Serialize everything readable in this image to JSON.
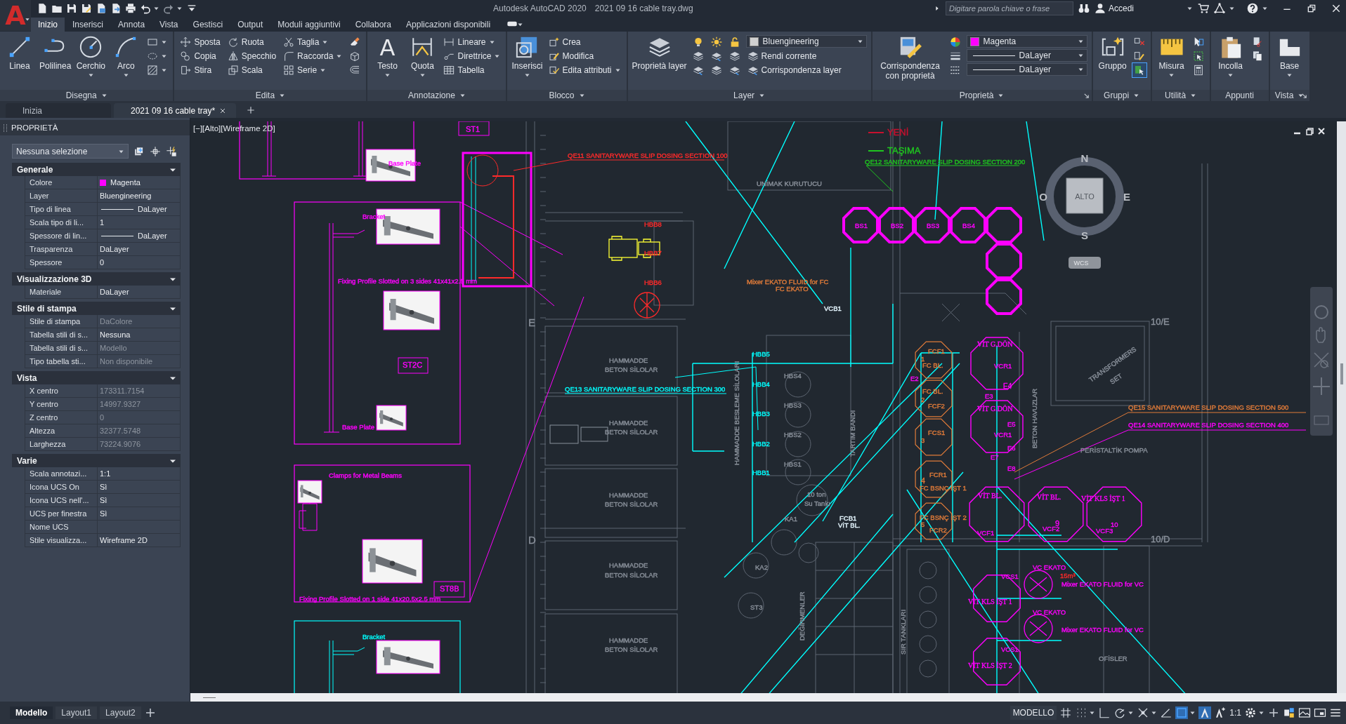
{
  "app_menu": {
    "glyph": "A"
  },
  "window": {
    "app_name": "Autodesk AutoCAD 2020",
    "file_name": "2021 09 16 cable tray.dwg"
  },
  "search": {
    "placeholder": "Digitare parola chiave o frase"
  },
  "sign_in": "Accedi",
  "ribbon_tabs": [
    {
      "label": "Inizio",
      "selected": true
    },
    {
      "label": "Inserisci",
      "selected": false
    },
    {
      "label": "Annota",
      "selected": false
    },
    {
      "label": "Vista",
      "selected": false
    },
    {
      "label": "Gestisci",
      "selected": false
    },
    {
      "label": "Output",
      "selected": false
    },
    {
      "label": "Moduli aggiuntivi",
      "selected": false
    },
    {
      "label": "Collabora",
      "selected": false
    },
    {
      "label": "Applicazioni disponibili",
      "selected": false
    }
  ],
  "ribbon_panels": [
    {
      "title": "Disegna",
      "title_menu": true,
      "launcher": false,
      "large": [
        {
          "label": "Linea",
          "menu": false
        },
        {
          "label": "Polilinea",
          "menu": false
        },
        {
          "label": "Cerchio",
          "menu": true
        },
        {
          "label": "Arco",
          "menu": true
        }
      ],
      "columns": [
        [
          {
            "kind": "icon",
            "menu": true
          },
          {
            "kind": "icon",
            "menu": true
          },
          {
            "kind": "icon",
            "menu": true
          }
        ]
      ]
    },
    {
      "title": "Edita",
      "title_menu": true,
      "launcher": false,
      "columns": [
        [
          {
            "kind": "tool",
            "label": "Sposta",
            "menu": false
          },
          {
            "kind": "tool",
            "label": "Copia",
            "menu": false
          },
          {
            "kind": "tool",
            "label": "Stira",
            "menu": false
          }
        ],
        [
          {
            "kind": "tool",
            "label": "Ruota",
            "menu": false
          },
          {
            "kind": "tool",
            "label": "Specchio",
            "menu": false
          },
          {
            "kind": "tool",
            "label": "Scala",
            "menu": false
          }
        ],
        [
          {
            "kind": "tool",
            "label": "Taglia",
            "menu": true
          },
          {
            "kind": "tool",
            "label": "Raccorda",
            "menu": true
          },
          {
            "kind": "tool",
            "label": "Serie",
            "menu": true
          }
        ],
        [
          {
            "kind": "icon",
            "menu": false
          },
          {
            "kind": "icon",
            "menu": false
          },
          {
            "kind": "icon",
            "menu": false
          }
        ]
      ]
    },
    {
      "title": "Annotazione",
      "title_menu": true,
      "launcher": false,
      "large": [
        {
          "label": "Testo",
          "glyph": "A",
          "menu": true
        },
        {
          "label": "Quota",
          "menu": true
        }
      ],
      "columns": [
        [
          {
            "kind": "tool",
            "label": "Lineare",
            "menu": true
          },
          {
            "kind": "tool",
            "label": "Direttrice",
            "menu": true
          },
          {
            "kind": "tool",
            "label": "Tabella",
            "menu": false
          }
        ]
      ]
    },
    {
      "title": "Blocco",
      "title_menu": true,
      "launcher": false,
      "large": [
        {
          "label": "Inserisci",
          "menu": true
        }
      ],
      "columns": [
        [
          {
            "kind": "tool",
            "label": "Crea",
            "menu": false
          },
          {
            "kind": "tool",
            "label": "Modifica",
            "menu": false
          },
          {
            "kind": "tool",
            "label": "Edita attributi",
            "menu": true
          }
        ]
      ]
    },
    {
      "title": "Layer",
      "title_menu": true,
      "launcher": false,
      "large": [
        {
          "label": "Proprietà layer",
          "menu": false
        }
      ],
      "columns": [
        [
          {
            "kind": "icon",
            "menu": false
          },
          {
            "kind": "icon",
            "menu": false
          },
          {
            "kind": "icon",
            "menu": false
          }
        ],
        [
          {
            "kind": "icon",
            "menu": false
          },
          {
            "kind": "icon",
            "menu": false
          },
          {
            "kind": "icon",
            "menu": false
          }
        ],
        [
          {
            "kind": "icon",
            "menu": false
          },
          {
            "kind": "icon",
            "menu": false
          },
          {
            "kind": "icon",
            "menu": false
          }
        ],
        [
          {
            "kind": "dropdown",
            "value": "Bluengineering",
            "color": "#d0d0d0"
          },
          {
            "kind": "tool",
            "label": "Rendi corrente",
            "menu": false
          },
          {
            "kind": "tool",
            "label": "Corrispondenza layer",
            "menu": false
          }
        ]
      ]
    },
    {
      "title": "Proprietà",
      "title_menu": true,
      "launcher": true,
      "large": [
        {
          "label": "Corrispondenza con proprietà",
          "menu": false
        }
      ],
      "columns": [
        [
          {
            "kind": "icon",
            "menu": false
          },
          {
            "kind": "icon",
            "menu": false
          },
          {
            "kind": "icon",
            "menu": false
          }
        ],
        [
          {
            "kind": "dropdown",
            "value": "Magenta",
            "color": "#ff00ff"
          },
          {
            "kind": "linetype",
            "value": "DaLayer"
          },
          {
            "kind": "linetype",
            "value": "DaLayer"
          }
        ]
      ]
    },
    {
      "title": "Gruppi",
      "title_menu": true,
      "launcher": false,
      "large": [
        {
          "label": "Gruppo",
          "menu": false
        }
      ],
      "columns": [
        [
          {
            "kind": "icon",
            "menu": false,
            "on": false
          },
          {
            "kind": "icon",
            "menu": false,
            "on": false
          },
          {
            "kind": "icon",
            "menu": false,
            "on": true
          }
        ]
      ]
    },
    {
      "title": "Utilità",
      "title_menu": true,
      "launcher": false,
      "large": [
        {
          "label": "Misura",
          "menu": true
        }
      ],
      "columns": [
        [
          {
            "kind": "icon",
            "menu": false
          },
          {
            "kind": "icon",
            "menu": false
          },
          {
            "kind": "icon",
            "menu": false
          }
        ]
      ]
    },
    {
      "title": "Appunti",
      "title_menu": false,
      "launcher": false,
      "large": [
        {
          "label": "Incolla",
          "menu": true
        }
      ],
      "columns": [
        [
          {
            "kind": "icon",
            "menu": false
          },
          {
            "kind": "icon",
            "menu": false
          }
        ]
      ]
    },
    {
      "title": "Vista",
      "title_menu": true,
      "launcher": true,
      "large": [
        {
          "label": "Base",
          "menu": true
        }
      ]
    }
  ],
  "doc_tabs": [
    {
      "label": "Inizia",
      "selected": false
    },
    {
      "label": "2021 09 16 cable tray*",
      "selected": true
    }
  ],
  "properties": {
    "title": "PROPRIETÀ",
    "selection": "Nessuna selezione",
    "sections": [
      {
        "title": "Generale",
        "expanded": true,
        "rows": [
          {
            "label": "Colore",
            "value": "Magenta",
            "kind": "color",
            "color": "#ff00ff",
            "disabled": false
          },
          {
            "label": "Layer",
            "value": "Bluengineering",
            "kind": "text",
            "disabled": false
          },
          {
            "label": "Tipo di linea",
            "value": "DaLayer",
            "kind": "linetype",
            "disabled": false
          },
          {
            "label": "Scala tipo di li...",
            "value": "1",
            "kind": "text",
            "disabled": false
          },
          {
            "label": "Spessore di lin...",
            "value": "DaLayer",
            "kind": "linetype",
            "disabled": false
          },
          {
            "label": "Trasparenza",
            "value": "DaLayer",
            "kind": "text",
            "disabled": false
          },
          {
            "label": "Spessore",
            "value": "0",
            "kind": "text",
            "disabled": false
          }
        ]
      },
      {
        "title": "Visualizzazione 3D",
        "expanded": true,
        "rows": [
          {
            "label": "Materiale",
            "value": "DaLayer",
            "kind": "text",
            "disabled": false
          }
        ]
      },
      {
        "title": "Stile di stampa",
        "expanded": true,
        "rows": [
          {
            "label": "Stile di stampa",
            "value": "DaColore",
            "kind": "text",
            "disabled": true
          },
          {
            "label": "Tabella stili di s...",
            "value": "Nessuna",
            "kind": "text",
            "disabled": false
          },
          {
            "label": "Tabella stili di s...",
            "value": "Modello",
            "kind": "text",
            "disabled": true
          },
          {
            "label": "Tipo tabella sti...",
            "value": "Non disponibile",
            "kind": "text",
            "disabled": true
          }
        ]
      },
      {
        "title": "Vista",
        "expanded": true,
        "rows": [
          {
            "label": "X centro",
            "value": "173311.7154",
            "kind": "text",
            "disabled": true
          },
          {
            "label": "Y centro",
            "value": "14997.9327",
            "kind": "text",
            "disabled": true
          },
          {
            "label": "Z centro",
            "value": "0",
            "kind": "text",
            "disabled": true
          },
          {
            "label": "Altezza",
            "value": "32377.5748",
            "kind": "text",
            "disabled": true
          },
          {
            "label": "Larghezza",
            "value": "73224.9076",
            "kind": "text",
            "disabled": true
          }
        ]
      },
      {
        "title": "Varie",
        "expanded": true,
        "rows": [
          {
            "label": "Scala annotazi...",
            "value": "1:1",
            "kind": "text",
            "disabled": false
          },
          {
            "label": "Icona UCS On",
            "value": "Sì",
            "kind": "text",
            "disabled": false
          },
          {
            "label": "Icona UCS nell'...",
            "value": "Sì",
            "kind": "text",
            "disabled": false
          },
          {
            "label": "UCS per finestra",
            "value": "Sì",
            "kind": "text",
            "disabled": false
          },
          {
            "label": "Nome UCS",
            "kind": "text"
          },
          {
            "label": "Stile visualizza...",
            "value": "Wireframe 2D",
            "kind": "text",
            "disabled": false
          }
        ]
      }
    ]
  },
  "viewport_label": "[−][Alto][Wireframe 2D]",
  "legend": [
    {
      "label": "YENİ",
      "color": "#c8102e"
    },
    {
      "label": "TAŞIMA",
      "color": "#1fc61f"
    }
  ],
  "viewcube": {
    "top": "ALTO",
    "north": "N",
    "south": "S",
    "east": "E",
    "west": "O",
    "coords": "WCS"
  },
  "drawing_labels": [
    {
      "text": "ST1",
      "color": "#ff00ff"
    },
    {
      "text": "Base Plate",
      "color": "#ff00ff"
    },
    {
      "text": "Bracket",
      "color": "#ff00ff"
    },
    {
      "text": "Fixing Profile Slotted on 3 sides 41x41x2.5 mm",
      "color": "#ff00ff"
    },
    {
      "text": "ST2C",
      "color": "#ff00ff"
    },
    {
      "text": "Base Plate",
      "color": "#ff00ff"
    },
    {
      "text": "Clamps for Metal Beams",
      "color": "#ff00ff"
    },
    {
      "text": "ST8B",
      "color": "#ff00ff"
    },
    {
      "text": "Fixing Profile Slotted on 1 side 41x20.5x2.5 mm",
      "color": "#ff00ff"
    },
    {
      "text": "Bracket",
      "color": "#00ffff"
    },
    {
      "text": "QE11 SANITARYWARE SLIP DOSING SECTION 100",
      "color": "#ff2a2a"
    },
    {
      "text": "UNİMAK KURUTUCU",
      "color": "#8a919b"
    },
    {
      "text": "HBB8",
      "color": "#ff2a2a"
    },
    {
      "text": "HBB7",
      "color": "#ff2a2a"
    },
    {
      "text": "HBB6",
      "color": "#ff2a2a"
    },
    {
      "text": "E",
      "color": "#8a919b"
    },
    {
      "text": "D",
      "color": "#8a919b"
    },
    {
      "text": "HAMMADDE",
      "color": "#8a919b"
    },
    {
      "text": "BETON SİLOLAR",
      "color": "#8a919b"
    },
    {
      "text": "QE13 SANITARYWARE SLIP DOSING SECTION 300",
      "color": "#00ffff"
    },
    {
      "text": "HAMMADDE",
      "color": "#8a919b"
    },
    {
      "text": "BETON SİLOLAR",
      "color": "#8a919b"
    },
    {
      "text": "HAMMADDE",
      "color": "#8a919b"
    },
    {
      "text": "BETON SİLOLAR",
      "color": "#8a919b"
    },
    {
      "text": "HAMMADDE",
      "color": "#8a919b"
    },
    {
      "text": "BETON SİLOLAR",
      "color": "#8a919b"
    },
    {
      "text": "HAMMADDE",
      "color": "#8a919b"
    },
    {
      "text": "BETON SİLOLAR",
      "color": "#8a919b"
    },
    {
      "text": "Mixer EKATO FLUID for FC",
      "color": "#e07b39"
    },
    {
      "text": "FC EKATO",
      "color": "#e07b39"
    },
    {
      "text": "VCB1",
      "color": "#e6f7ff"
    },
    {
      "text": "HAMMADDE BESLEME SİLOLARI",
      "color": "#8a919b"
    },
    {
      "text": "HBB5",
      "color": "#00ffff"
    },
    {
      "text": "HBB4",
      "color": "#00ffff"
    },
    {
      "text": "HBB3",
      "color": "#00ffff"
    },
    {
      "text": "HBB2",
      "color": "#00ffff"
    },
    {
      "text": "HBB1",
      "color": "#00ffff"
    },
    {
      "text": "HBS4",
      "color": "#8a919b"
    },
    {
      "text": "HBS3",
      "color": "#8a919b"
    },
    {
      "text": "HBS2",
      "color": "#8a919b"
    },
    {
      "text": "HBS1",
      "color": "#8a919b"
    },
    {
      "text": "TARTIM BANDI",
      "color": "#8a919b"
    },
    {
      "text": "10 ton",
      "color": "#8a919b"
    },
    {
      "text": "Su Tankı",
      "color": "#8a919b"
    },
    {
      "text": "FCB1",
      "color": "#e6f7ff"
    },
    {
      "text": "VİT BL.",
      "color": "#e6f7ff"
    },
    {
      "text": "KA1",
      "color": "#8a919b"
    },
    {
      "text": "KA2",
      "color": "#8a919b"
    },
    {
      "text": "ST3",
      "color": "#8a919b"
    },
    {
      "text": "DEĞİRMENLER",
      "color": "#8a919b"
    },
    {
      "text": "QE12 SANITARYWARE SLIP DOSING SECTION 200",
      "color": "#1fc61f"
    },
    {
      "text": "BS1",
      "color": "#ff00ff"
    },
    {
      "text": "BS2",
      "color": "#ff00ff"
    },
    {
      "text": "BS3",
      "color": "#ff00ff"
    },
    {
      "text": "BS4",
      "color": "#ff00ff"
    },
    {
      "text": "10/E",
      "color": "#8a919b"
    },
    {
      "text": "TRANSFORMERS",
      "color": "#8a919b"
    },
    {
      "text": "SET",
      "color": "#8a919b"
    },
    {
      "text": "QE15 SANITARYWARE SLIP DOSING SECTION 500",
      "color": "#e07b39"
    },
    {
      "text": "QE14 SANITARYWARE SLIP DOSING SECTION 400",
      "color": "#ff00ff"
    },
    {
      "text": "10/D",
      "color": "#8a919b"
    },
    {
      "text": "PERİSTALTİK POMPA",
      "color": "#8a919b"
    },
    {
      "text": "BETON HAVUZLAR",
      "color": "#8a919b"
    },
    {
      "text": "VİT G.DÖN",
      "color": "#ff00ff"
    },
    {
      "text": "VCR1",
      "color": "#ff00ff"
    },
    {
      "text": "VİT G.DÖN",
      "color": "#ff00ff"
    },
    {
      "text": "VCR1",
      "color": "#ff00ff"
    },
    {
      "text": "E2",
      "color": "#ff00ff"
    },
    {
      "text": "E3",
      "color": "#ff00ff"
    },
    {
      "text": "E4",
      "color": "#ff00ff"
    },
    {
      "text": "E5",
      "color": "#ff00ff"
    },
    {
      "text": "E6",
      "color": "#ff00ff"
    },
    {
      "text": "E7",
      "color": "#ff00ff"
    },
    {
      "text": "E8",
      "color": "#ff00ff"
    },
    {
      "text": "FCF1",
      "color": "#e07b39"
    },
    {
      "text": "FC BL.",
      "color": "#e07b39"
    },
    {
      "text": "FC BL.",
      "color": "#e07b39"
    },
    {
      "text": "FCF2",
      "color": "#e07b39"
    },
    {
      "text": "FCS1",
      "color": "#e07b39"
    },
    {
      "text": "FCR1",
      "color": "#e07b39"
    },
    {
      "text": "FC BSNÇ İŞT 1",
      "color": "#e07b39"
    },
    {
      "text": "FC BSNÇ İŞT 2",
      "color": "#e07b39"
    },
    {
      "text": "FCR2",
      "color": "#e07b39"
    },
    {
      "text": "1",
      "color": "#e07b39"
    },
    {
      "text": "2",
      "color": "#e07b39"
    },
    {
      "text": "3",
      "color": "#e07b39"
    },
    {
      "text": "4",
      "color": "#e07b39"
    },
    {
      "text": "5",
      "color": "#e07b39"
    },
    {
      "text": "VİT BL.",
      "color": "#ff00ff"
    },
    {
      "text": "VİT BL.",
      "color": "#ff00ff"
    },
    {
      "text": "VİT KLS İŞT 1",
      "color": "#ff00ff"
    },
    {
      "text": "VCF1",
      "color": "#ff00ff"
    },
    {
      "text": "VCF2",
      "color": "#ff00ff"
    },
    {
      "text": "VCF3",
      "color": "#ff00ff"
    },
    {
      "text": "9",
      "color": "#ff00ff"
    },
    {
      "text": "10",
      "color": "#ff00ff"
    },
    {
      "text": "VCS1",
      "color": "#ff00ff"
    },
    {
      "text": "VİT KLS İŞT 1",
      "color": "#ff00ff"
    },
    {
      "text": "VCS1",
      "color": "#ff00ff"
    },
    {
      "text": "VİT KLS İŞT 2",
      "color": "#ff00ff"
    },
    {
      "text": "VC EKATO",
      "color": "#ff00ff"
    },
    {
      "text": "VC EKATO",
      "color": "#ff00ff"
    },
    {
      "text": "15m³",
      "color": "#ff2a2a"
    },
    {
      "text": "Mixer EKATO FLUID for VC",
      "color": "#ff00ff"
    },
    {
      "text": "Mixer EKATO FLUID for VC",
      "color": "#ff00ff"
    },
    {
      "text": "OFİSLER",
      "color": "#8a919b"
    },
    {
      "text": "SIR TANKLARI",
      "color": "#8a919b"
    }
  ],
  "layout_tabs": [
    {
      "label": "Modello",
      "selected": true
    },
    {
      "label": "Layout1",
      "selected": false
    },
    {
      "label": "Layout2",
      "selected": false
    }
  ],
  "status": {
    "space": "MODELLO",
    "scale": "1:1"
  },
  "status_toggles": [
    {
      "on": false
    },
    {
      "on": false
    },
    {
      "on": false
    },
    {
      "on": false
    },
    {
      "on": false
    },
    {
      "on": false
    },
    {
      "on": true
    },
    {
      "on": true
    },
    {
      "on": false
    },
    {
      "on": false
    }
  ]
}
